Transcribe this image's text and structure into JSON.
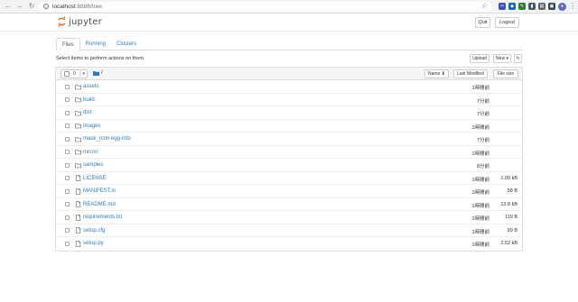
{
  "browser": {
    "url_host": "localhost",
    "url_rest": ":8888/tree",
    "ext_colors": [
      "#3f51b5",
      "#1565c0",
      "#2e7d32",
      "#455a64",
      "#616161",
      "#37474f"
    ]
  },
  "header": {
    "logo_text": "jupyter",
    "quit_label": "Quit",
    "logout_label": "Logout"
  },
  "tabs": [
    {
      "label": "Files",
      "active": true
    },
    {
      "label": "Running",
      "active": false
    },
    {
      "label": "Clusters",
      "active": false
    }
  ],
  "toolbar": {
    "hint": "Select items to perform actions on them.",
    "upload_label": "Upload",
    "new_label": "New ▾",
    "refresh_icon": "↻"
  },
  "list_header": {
    "selected_count": "0",
    "crumb_sep": "/",
    "name_label": "Name ⬇",
    "modified_label": "Last Modified",
    "size_label": "File size"
  },
  "files": [
    {
      "name": "assets",
      "type": "folder",
      "modified": "1時間前",
      "size": ""
    },
    {
      "name": "build",
      "type": "folder",
      "modified": "7分前",
      "size": ""
    },
    {
      "name": "dist",
      "type": "folder",
      "modified": "7分前",
      "size": ""
    },
    {
      "name": "images",
      "type": "folder",
      "modified": "1時間前",
      "size": ""
    },
    {
      "name": "mask_rcnn.egg-info",
      "type": "folder",
      "modified": "7分前",
      "size": ""
    },
    {
      "name": "mrcnn",
      "type": "folder",
      "modified": "1時間前",
      "size": ""
    },
    {
      "name": "samples",
      "type": "folder",
      "modified": "8分前",
      "size": ""
    },
    {
      "name": "LICENSE",
      "type": "file",
      "modified": "1時間前",
      "size": "1.09 kB"
    },
    {
      "name": "MANIFEST.in",
      "type": "file",
      "modified": "1時間前",
      "size": "58 B"
    },
    {
      "name": "README.md",
      "type": "file",
      "modified": "1時間前",
      "size": "13.8 kB"
    },
    {
      "name": "requirements.txt",
      "type": "file",
      "modified": "1時間前",
      "size": "119 B"
    },
    {
      "name": "setup.cfg",
      "type": "file",
      "modified": "1時間前",
      "size": "99 B"
    },
    {
      "name": "setup.py",
      "type": "file",
      "modified": "1時間前",
      "size": "2.52 kB"
    }
  ]
}
